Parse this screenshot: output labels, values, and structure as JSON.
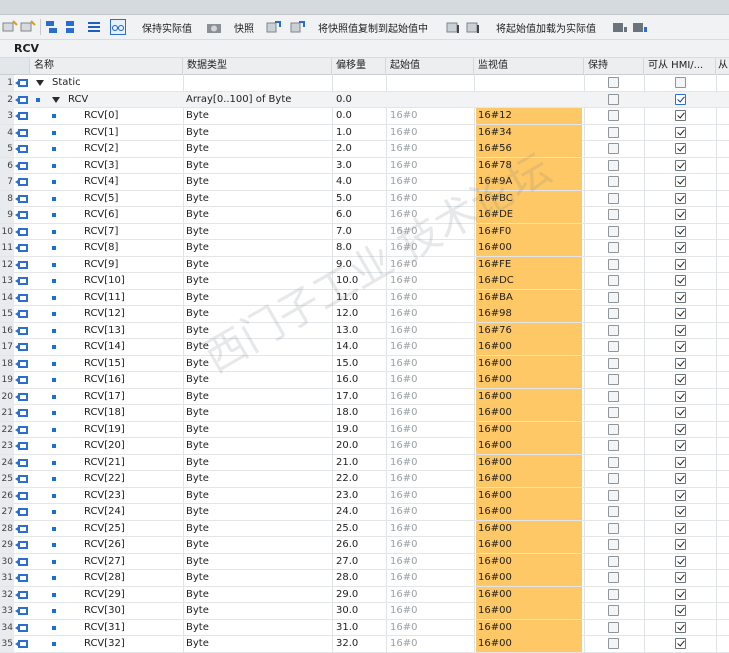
{
  "toolbar": {
    "keep_actual_label": "保持实际值",
    "snapshot_label": "快照",
    "copy_snapshot_label": "将快照值复制到起始值中",
    "load_start_label": "将起始值加载为实际值"
  },
  "block_title": "RCV",
  "columns": {
    "name": "名称",
    "type": "数据类型",
    "offset": "偏移量",
    "start": "起始值",
    "monitor": "监视值",
    "retain": "保持",
    "hmi": "可从 HMI/...",
    "from": "从"
  },
  "colors": {
    "monitor_highlight": "#ffc866",
    "row_bullet": "#1a6fd0",
    "header_bg": "#eceeef"
  },
  "watermark": "西门子工业 技术论坛 support.industry.siemens.com/cs",
  "rows": [
    {
      "num": "1",
      "name": "Static",
      "type": "",
      "offset": "",
      "start": "",
      "monitor": "",
      "level": 0,
      "expand": true,
      "retain": false,
      "hmi": false,
      "retain_blank": true
    },
    {
      "num": "2",
      "name": "RCV",
      "type": "Array[0..100] of Byte",
      "offset": "0.0",
      "start": "",
      "monitor": "",
      "level": 1,
      "expand": true,
      "retain": false,
      "hmi": true,
      "hmi_blue": true
    },
    {
      "num": "3",
      "name": "RCV[0]",
      "type": "Byte",
      "offset": "0.0",
      "start": "16#0",
      "monitor": "16#12",
      "level": 2
    },
    {
      "num": "4",
      "name": "RCV[1]",
      "type": "Byte",
      "offset": "1.0",
      "start": "16#0",
      "monitor": "16#34",
      "level": 2
    },
    {
      "num": "5",
      "name": "RCV[2]",
      "type": "Byte",
      "offset": "2.0",
      "start": "16#0",
      "monitor": "16#56",
      "level": 2
    },
    {
      "num": "6",
      "name": "RCV[3]",
      "type": "Byte",
      "offset": "3.0",
      "start": "16#0",
      "monitor": "16#78",
      "level": 2
    },
    {
      "num": "7",
      "name": "RCV[4]",
      "type": "Byte",
      "offset": "4.0",
      "start": "16#0",
      "monitor": "16#9A",
      "level": 2
    },
    {
      "num": "8",
      "name": "RCV[5]",
      "type": "Byte",
      "offset": "5.0",
      "start": "16#0",
      "monitor": "16#BC",
      "level": 2
    },
    {
      "num": "9",
      "name": "RCV[6]",
      "type": "Byte",
      "offset": "6.0",
      "start": "16#0",
      "monitor": "16#DE",
      "level": 2
    },
    {
      "num": "10",
      "name": "RCV[7]",
      "type": "Byte",
      "offset": "7.0",
      "start": "16#0",
      "monitor": "16#F0",
      "level": 2
    },
    {
      "num": "11",
      "name": "RCV[8]",
      "type": "Byte",
      "offset": "8.0",
      "start": "16#0",
      "monitor": "16#00",
      "level": 2
    },
    {
      "num": "12",
      "name": "RCV[9]",
      "type": "Byte",
      "offset": "9.0",
      "start": "16#0",
      "monitor": "16#FE",
      "level": 2
    },
    {
      "num": "13",
      "name": "RCV[10]",
      "type": "Byte",
      "offset": "10.0",
      "start": "16#0",
      "monitor": "16#DC",
      "level": 2
    },
    {
      "num": "14",
      "name": "RCV[11]",
      "type": "Byte",
      "offset": "11.0",
      "start": "16#0",
      "monitor": "16#BA",
      "level": 2
    },
    {
      "num": "15",
      "name": "RCV[12]",
      "type": "Byte",
      "offset": "12.0",
      "start": "16#0",
      "monitor": "16#98",
      "level": 2
    },
    {
      "num": "16",
      "name": "RCV[13]",
      "type": "Byte",
      "offset": "13.0",
      "start": "16#0",
      "monitor": "16#76",
      "level": 2
    },
    {
      "num": "17",
      "name": "RCV[14]",
      "type": "Byte",
      "offset": "14.0",
      "start": "16#0",
      "monitor": "16#00",
      "level": 2
    },
    {
      "num": "18",
      "name": "RCV[15]",
      "type": "Byte",
      "offset": "15.0",
      "start": "16#0",
      "monitor": "16#00",
      "level": 2
    },
    {
      "num": "19",
      "name": "RCV[16]",
      "type": "Byte",
      "offset": "16.0",
      "start": "16#0",
      "monitor": "16#00",
      "level": 2
    },
    {
      "num": "20",
      "name": "RCV[17]",
      "type": "Byte",
      "offset": "17.0",
      "start": "16#0",
      "monitor": "16#00",
      "level": 2
    },
    {
      "num": "21",
      "name": "RCV[18]",
      "type": "Byte",
      "offset": "18.0",
      "start": "16#0",
      "monitor": "16#00",
      "level": 2
    },
    {
      "num": "22",
      "name": "RCV[19]",
      "type": "Byte",
      "offset": "19.0",
      "start": "16#0",
      "monitor": "16#00",
      "level": 2
    },
    {
      "num": "23",
      "name": "RCV[20]",
      "type": "Byte",
      "offset": "20.0",
      "start": "16#0",
      "monitor": "16#00",
      "level": 2
    },
    {
      "num": "24",
      "name": "RCV[21]",
      "type": "Byte",
      "offset": "21.0",
      "start": "16#0",
      "monitor": "16#00",
      "level": 2
    },
    {
      "num": "25",
      "name": "RCV[22]",
      "type": "Byte",
      "offset": "22.0",
      "start": "16#0",
      "monitor": "16#00",
      "level": 2
    },
    {
      "num": "26",
      "name": "RCV[23]",
      "type": "Byte",
      "offset": "23.0",
      "start": "16#0",
      "monitor": "16#00",
      "level": 2
    },
    {
      "num": "27",
      "name": "RCV[24]",
      "type": "Byte",
      "offset": "24.0",
      "start": "16#0",
      "monitor": "16#00",
      "level": 2
    },
    {
      "num": "28",
      "name": "RCV[25]",
      "type": "Byte",
      "offset": "25.0",
      "start": "16#0",
      "monitor": "16#00",
      "level": 2
    },
    {
      "num": "29",
      "name": "RCV[26]",
      "type": "Byte",
      "offset": "26.0",
      "start": "16#0",
      "monitor": "16#00",
      "level": 2
    },
    {
      "num": "30",
      "name": "RCV[27]",
      "type": "Byte",
      "offset": "27.0",
      "start": "16#0",
      "monitor": "16#00",
      "level": 2
    },
    {
      "num": "31",
      "name": "RCV[28]",
      "type": "Byte",
      "offset": "28.0",
      "start": "16#0",
      "monitor": "16#00",
      "level": 2
    },
    {
      "num": "32",
      "name": "RCV[29]",
      "type": "Byte",
      "offset": "29.0",
      "start": "16#0",
      "monitor": "16#00",
      "level": 2
    },
    {
      "num": "33",
      "name": "RCV[30]",
      "type": "Byte",
      "offset": "30.0",
      "start": "16#0",
      "monitor": "16#00",
      "level": 2
    },
    {
      "num": "34",
      "name": "RCV[31]",
      "type": "Byte",
      "offset": "31.0",
      "start": "16#0",
      "monitor": "16#00",
      "level": 2
    },
    {
      "num": "35",
      "name": "RCV[32]",
      "type": "Byte",
      "offset": "32.0",
      "start": "16#0",
      "monitor": "16#00",
      "level": 2
    }
  ]
}
